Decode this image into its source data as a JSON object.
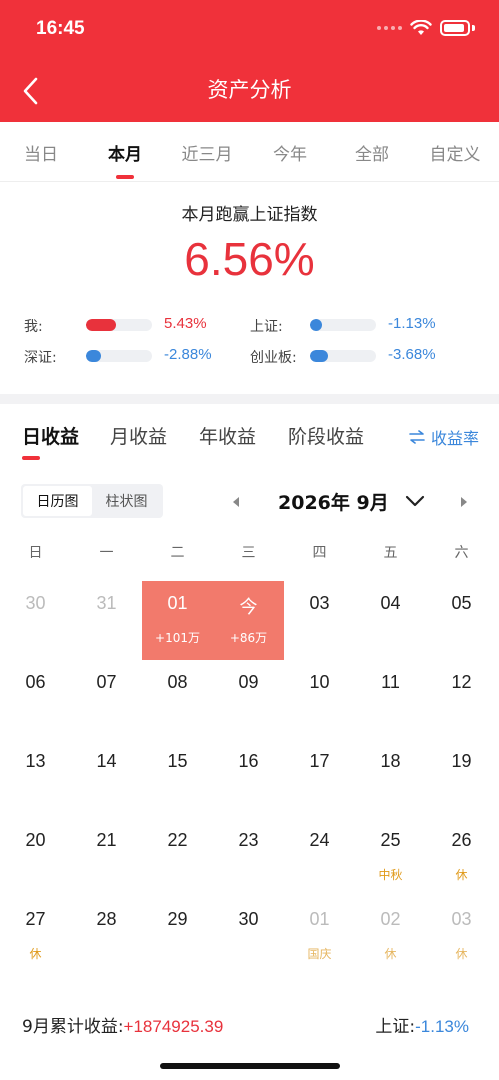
{
  "status_bar": {
    "time": "16:45"
  },
  "nav": {
    "title": "资产分析"
  },
  "period_tabs": [
    {
      "label": "当日"
    },
    {
      "label": "本月"
    },
    {
      "label": "近三月"
    },
    {
      "label": "今年"
    },
    {
      "label": "全部"
    },
    {
      "label": "自定义"
    }
  ],
  "summary": {
    "title": "本月跑赢上证指数",
    "value": "6.56%",
    "comparisons": [
      {
        "label": "我:",
        "value": "5.43%",
        "color": "#e8323c",
        "fill": 0.45
      },
      {
        "label": "上证:",
        "value": "-1.13%",
        "color": "#3b87db",
        "fill": 0.1
      },
      {
        "label": "深证:",
        "value": "-2.88%",
        "color": "#3b87db",
        "fill": 0.22
      },
      {
        "label": "创业板:",
        "value": "-3.68%",
        "color": "#3b87db",
        "fill": 0.28
      }
    ]
  },
  "profit_tabs": [
    {
      "label": "日收益"
    },
    {
      "label": "月收益"
    },
    {
      "label": "年收益"
    },
    {
      "label": "阶段收益"
    }
  ],
  "rate_link": {
    "icon": "swap-arrows-icon",
    "label": "收益率"
  },
  "view_toggle": {
    "calendar": "日历图",
    "bar": "柱状图"
  },
  "calendar": {
    "month_label": "2026年 9月",
    "weekdays": [
      "日",
      "一",
      "二",
      "三",
      "四",
      "五",
      "六"
    ],
    "days": [
      {
        "d": "30",
        "dim": true
      },
      {
        "d": "31",
        "dim": true
      },
      {
        "d": "01",
        "hl": true,
        "sub": "+101万"
      },
      {
        "d": "今",
        "hl": true,
        "sub": "+86万"
      },
      {
        "d": "03"
      },
      {
        "d": "04"
      },
      {
        "d": "05"
      },
      {
        "d": "06"
      },
      {
        "d": "07"
      },
      {
        "d": "08"
      },
      {
        "d": "09"
      },
      {
        "d": "10"
      },
      {
        "d": "11"
      },
      {
        "d": "12"
      },
      {
        "d": "13"
      },
      {
        "d": "14"
      },
      {
        "d": "15"
      },
      {
        "d": "16"
      },
      {
        "d": "17"
      },
      {
        "d": "18"
      },
      {
        "d": "19"
      },
      {
        "d": "20"
      },
      {
        "d": "21"
      },
      {
        "d": "22"
      },
      {
        "d": "23"
      },
      {
        "d": "24"
      },
      {
        "d": "25",
        "sub": "中秋",
        "holiday": true
      },
      {
        "d": "26",
        "sub": "休",
        "holiday": true
      },
      {
        "d": "27",
        "sub": "休",
        "holiday": true
      },
      {
        "d": "28"
      },
      {
        "d": "29"
      },
      {
        "d": "30"
      },
      {
        "d": "01",
        "dim": true,
        "sub": "国庆",
        "holiday": true
      },
      {
        "d": "02",
        "dim": true,
        "sub": "休",
        "holiday": true
      },
      {
        "d": "03",
        "dim": true,
        "sub": "休",
        "holiday": true
      }
    ]
  },
  "footer": {
    "month_total_label": "9月累计收益:",
    "month_total_value": "+1874925.39",
    "index_label": "上证:",
    "index_value": "-1.13%"
  },
  "colors": {
    "brand": "#f0313a",
    "up": "#e8323c",
    "down": "#3b87db",
    "highlight": "#f27a6c",
    "holiday": "#e09a1a"
  }
}
